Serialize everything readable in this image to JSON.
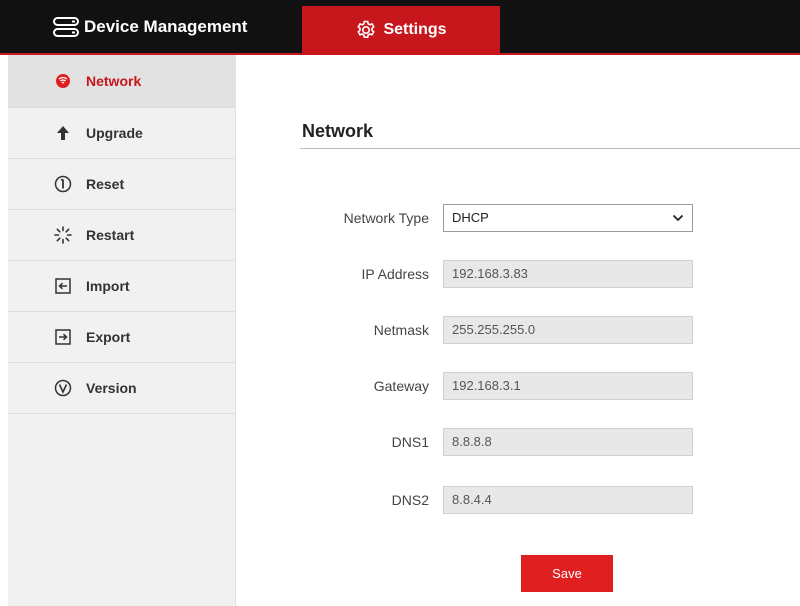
{
  "header": {
    "brand_label": "Device Management",
    "brand_icon": "server-icon",
    "settings_tab_label": "Settings",
    "settings_tab_icon": "gear-icon"
  },
  "sidebar": {
    "items": [
      {
        "label": "Network",
        "icon": "network-icon",
        "active": true
      },
      {
        "label": "Upgrade",
        "icon": "arrow-up-icon",
        "active": false
      },
      {
        "label": "Reset",
        "icon": "reset-icon",
        "active": false
      },
      {
        "label": "Restart",
        "icon": "spinner-icon",
        "active": false
      },
      {
        "label": "Import",
        "icon": "import-icon",
        "active": false
      },
      {
        "label": "Export",
        "icon": "export-icon",
        "active": false
      },
      {
        "label": "Version",
        "icon": "version-icon",
        "active": false
      }
    ]
  },
  "main": {
    "title": "Network",
    "fields": {
      "network_type": {
        "label": "Network Type",
        "value": "DHCP"
      },
      "ip_address": {
        "label": "IP Address",
        "value": "192.168.3.83"
      },
      "netmask": {
        "label": "Netmask",
        "value": "255.255.255.0"
      },
      "gateway": {
        "label": "Gateway",
        "value": "192.168.3.1"
      },
      "dns1": {
        "label": "DNS1",
        "value": "8.8.8.8"
      },
      "dns2": {
        "label": "DNS2",
        "value": "8.8.4.4"
      }
    },
    "save_label": "Save"
  },
  "colors": {
    "accent": "#c8161d",
    "topbar": "#111111",
    "sidebar": "#f1f1f1",
    "save_button": "#e02020"
  }
}
